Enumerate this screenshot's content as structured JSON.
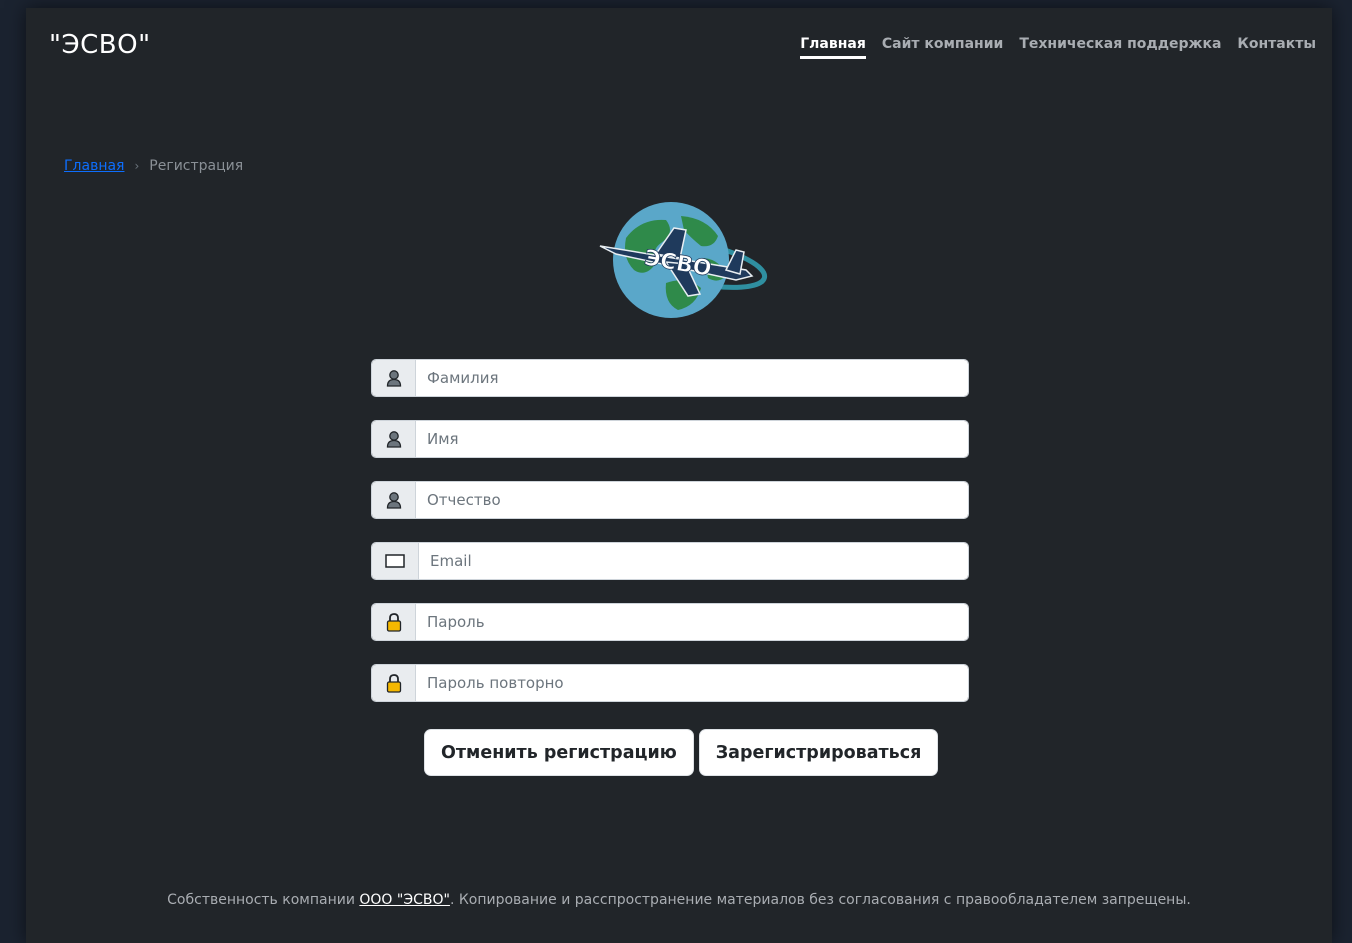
{
  "brand": "\"ЭСВО\"",
  "nav": {
    "items": [
      {
        "label": "Главная",
        "active": true
      },
      {
        "label": "Сайт компании",
        "active": false
      },
      {
        "label": "Техническая поддержка",
        "active": false
      },
      {
        "label": "Контакты",
        "active": false
      }
    ]
  },
  "breadcrumb": {
    "home": "Главная",
    "separator": "›",
    "current": "Регистрация"
  },
  "logo": {
    "text": "ЭСВО",
    "icon": "globe-airplane-logo"
  },
  "form": {
    "fields": [
      {
        "placeholder": "Фамилия",
        "value": "",
        "icon": "user-icon"
      },
      {
        "placeholder": "Имя",
        "value": "",
        "icon": "user-icon"
      },
      {
        "placeholder": "Отчество",
        "value": "",
        "icon": "user-icon"
      },
      {
        "placeholder": "Email",
        "value": "",
        "icon": "email-icon"
      },
      {
        "placeholder": "Пароль",
        "value": "",
        "icon": "lock-icon"
      },
      {
        "placeholder": "Пароль повторно",
        "value": "",
        "icon": "lock-icon"
      }
    ]
  },
  "buttons": {
    "cancel": "Отменить регистрацию",
    "register": "Зарегистрироваться"
  },
  "footer": {
    "prefix": "Собственность компании",
    "company": "ООО \"ЭСВО\"",
    "suffix": ". Копирование и расспространение материалов без согласования с правообладателем запрещены."
  },
  "colors": {
    "background": "#212529",
    "outer": "#1b2330",
    "link": "#0d6efd",
    "lock": "#f5b800"
  }
}
